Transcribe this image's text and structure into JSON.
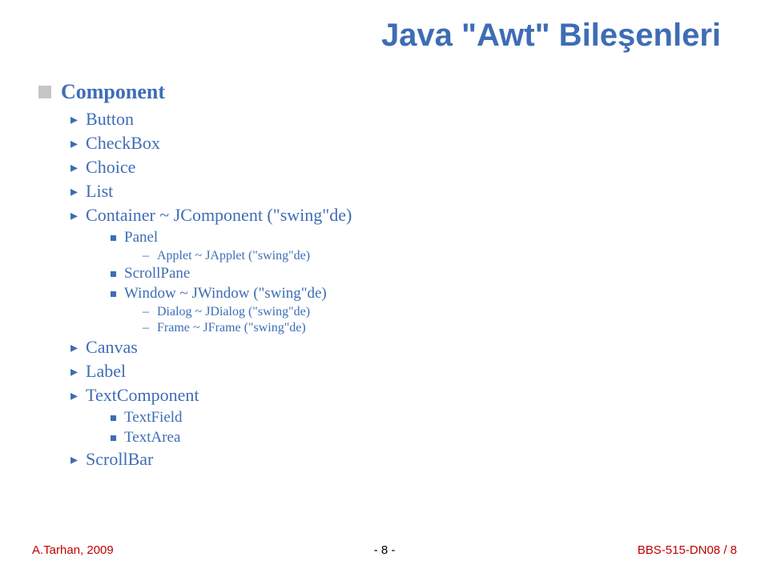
{
  "title": "Java \"Awt\" Bileşenleri",
  "items": {
    "component": "Component",
    "button": "Button",
    "checkbox": "CheckBox",
    "choice": "Choice",
    "list": "List",
    "container": "Container ~ JComponent (\"swing\"de)",
    "panel": "Panel",
    "applet": "Applet ~ JApplet (\"swing\"de)",
    "scrollpane": "ScrollPane",
    "window": "Window ~ JWindow (\"swing\"de)",
    "dialog": "Dialog ~ JDialog (\"swing\"de)",
    "frame": "Frame ~ JFrame (\"swing\"de)",
    "canvas": "Canvas",
    "label": "Label",
    "textcomponent": "TextComponent",
    "textfield": "TextField",
    "textarea": "TextArea",
    "scrollbar": "ScrollBar"
  },
  "footer": {
    "left": "A.Tarhan, 2009",
    "center": "- 8 -",
    "right": "BBS-515-DN08 / 8"
  }
}
